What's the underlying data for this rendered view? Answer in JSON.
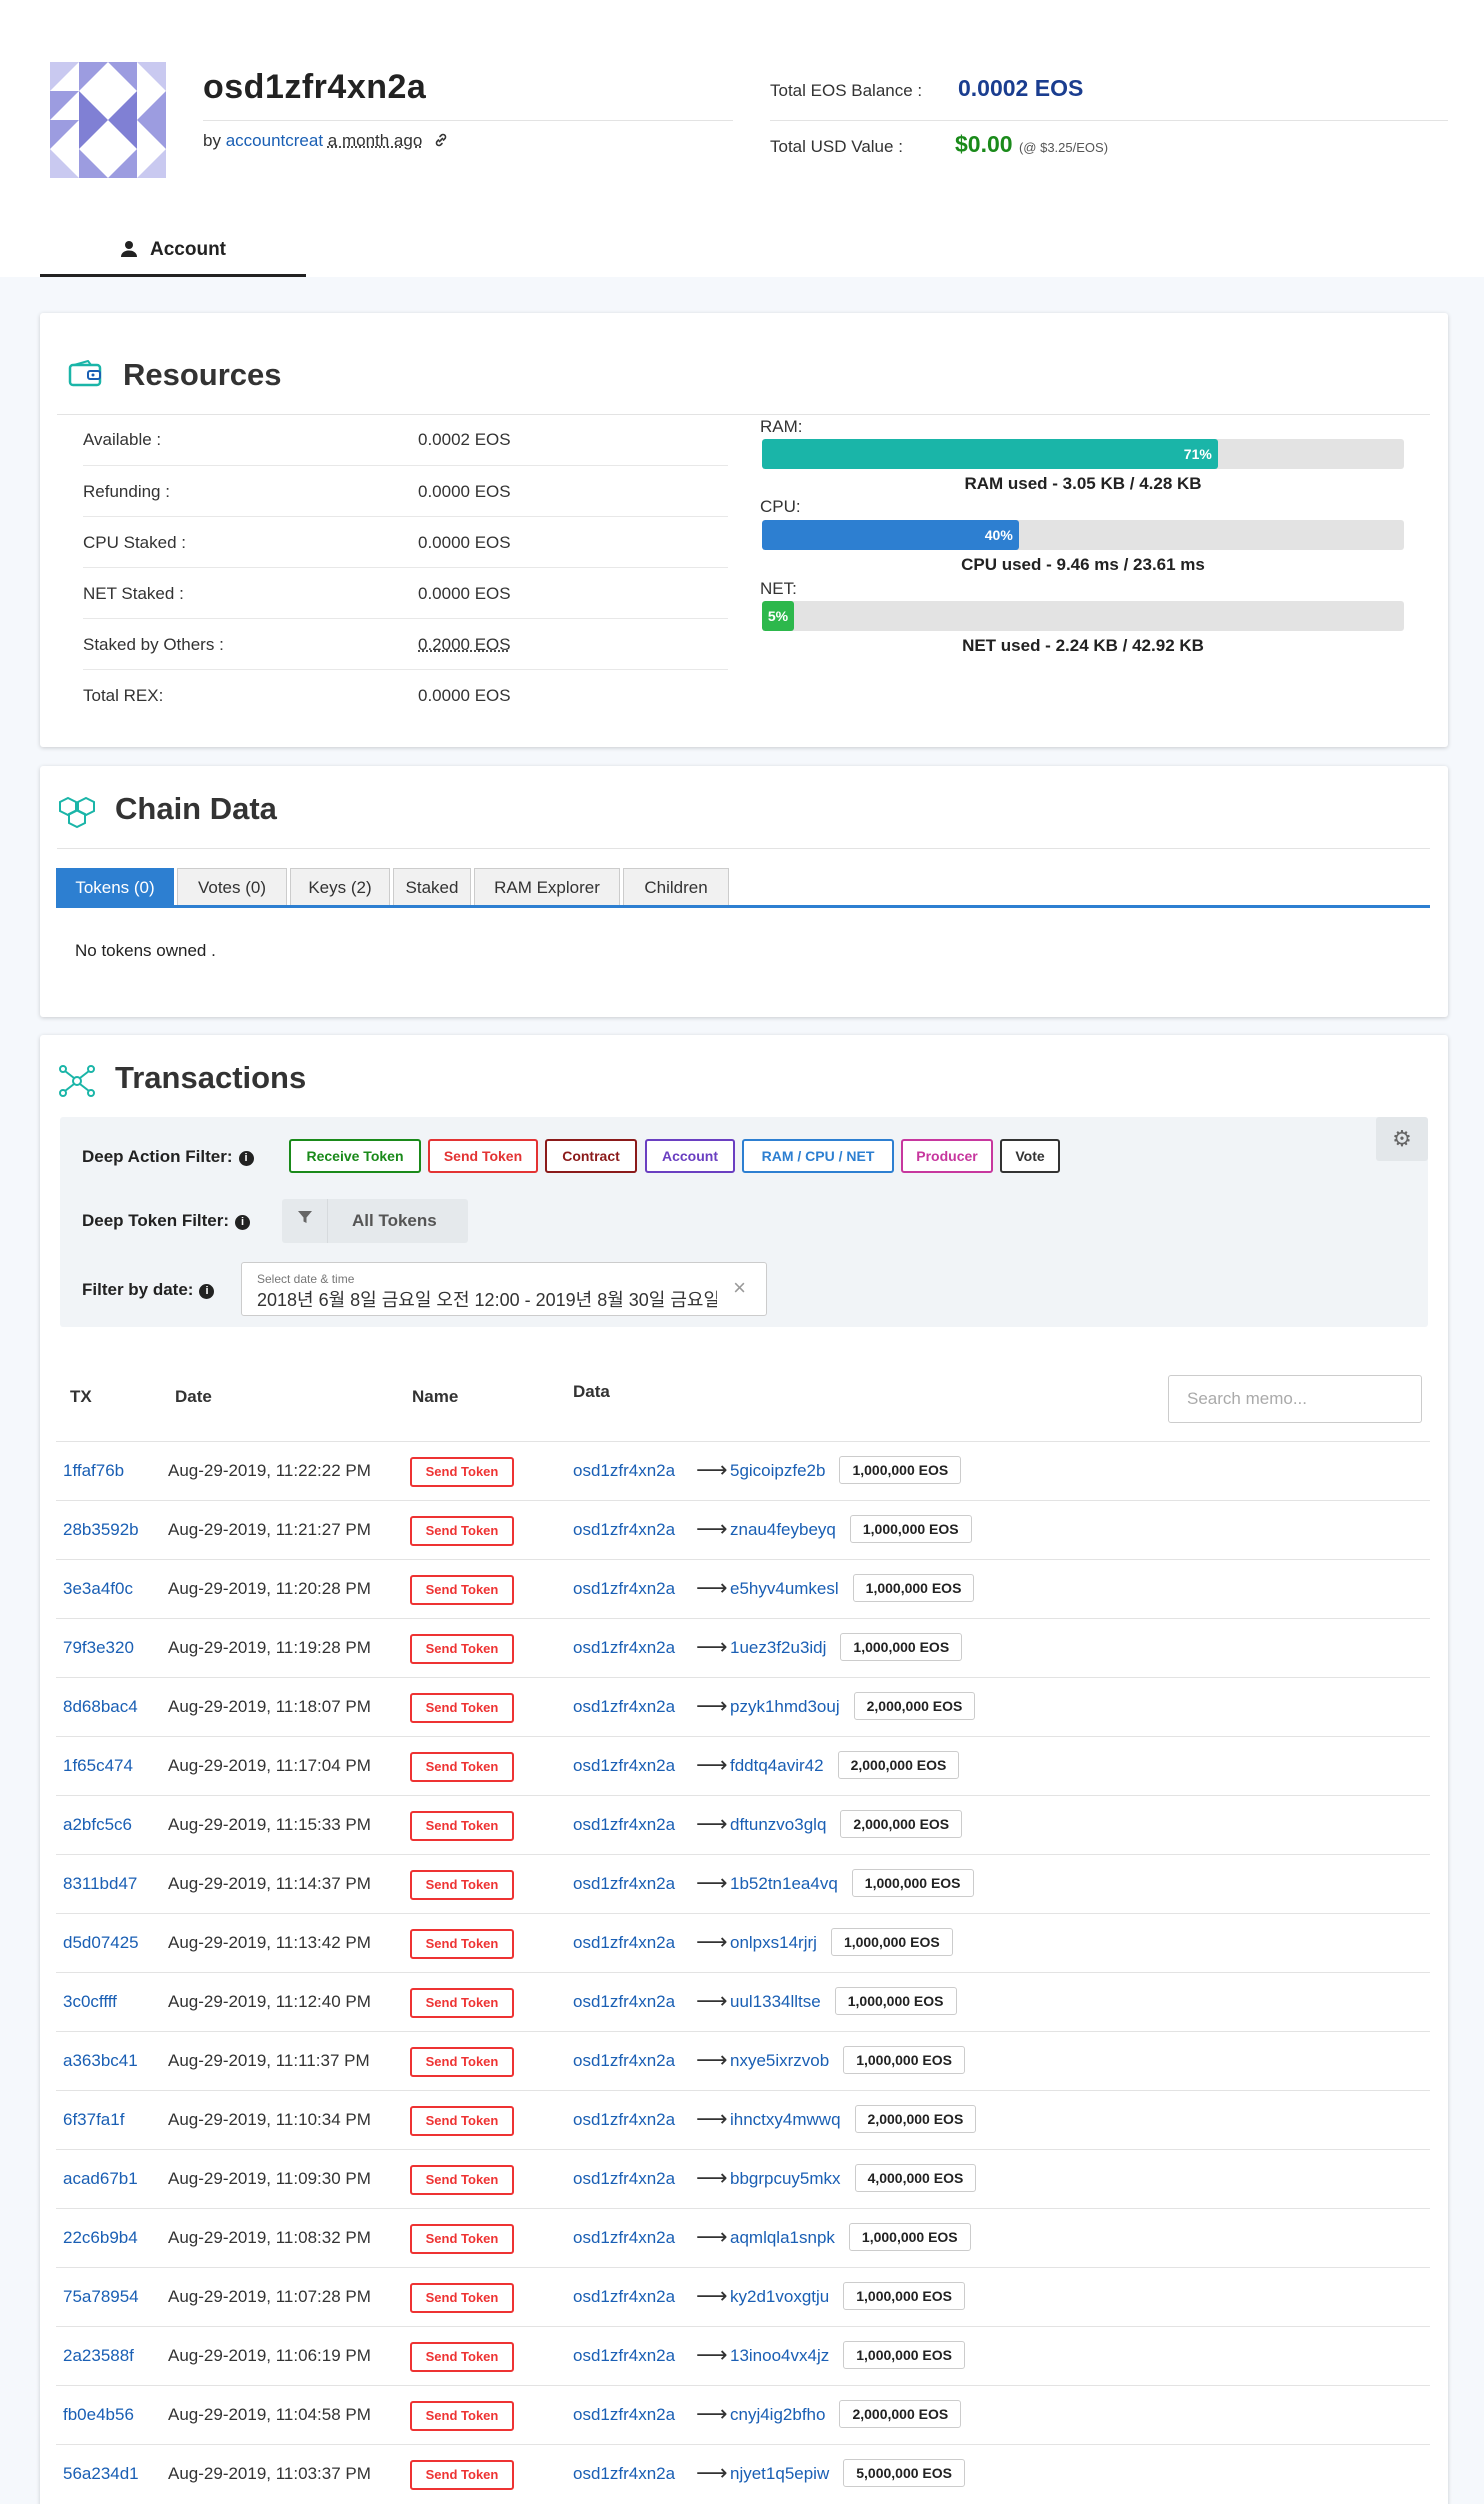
{
  "account": {
    "name": "osd1zfr4xn2a",
    "by_prefix": "by",
    "creator": "accountcreat",
    "created_ago": "a month ago"
  },
  "balance": {
    "eos_label": "Total EOS Balance :",
    "eos_value": "0.0002 EOS",
    "usd_label": "Total USD Value :",
    "usd_value": "$0.00",
    "usd_rate": "(@ $3.25/EOS)"
  },
  "tabs": {
    "account": "Account"
  },
  "resources": {
    "title": "Resources",
    "rows": [
      {
        "label": "Available :",
        "value": "0.0002 EOS"
      },
      {
        "label": "Refunding :",
        "value": "0.0000 EOS"
      },
      {
        "label": "CPU Staked :",
        "value": "0.0000 EOS"
      },
      {
        "label": "NET Staked :",
        "value": "0.0000 EOS"
      },
      {
        "label": "Staked by Others :",
        "value": "0.2000 EOS"
      },
      {
        "label": "Total REX:",
        "value": "0.0000 EOS"
      }
    ],
    "meters": [
      {
        "label": "RAM:",
        "percent": 71,
        "percent_text": "71%",
        "caption": "RAM used - 3.05 KB / 4.28 KB",
        "color": "#1ab5a8"
      },
      {
        "label": "CPU:",
        "percent": 40,
        "percent_text": "40%",
        "caption": "CPU used - 9.46 ms / 23.61 ms",
        "color": "#2d7fd1"
      },
      {
        "label": "NET:",
        "percent": 5,
        "percent_text": "5%",
        "caption": "NET used - 2.24 KB / 42.92 KB",
        "color": "#2db84c"
      }
    ]
  },
  "chain_data": {
    "title": "Chain Data",
    "tabs": [
      "Tokens (0)",
      "Votes (0)",
      "Keys (2)",
      "Staked",
      "RAM Explorer",
      "Children"
    ],
    "empty_text": "No tokens owned ."
  },
  "transactions": {
    "title": "Transactions",
    "deep_action_label": "Deep Action Filter:",
    "deep_token_label": "Deep Token Filter:",
    "date_label": "Filter by date:",
    "action_filters": [
      {
        "label": "Receive Token",
        "color": "#1a8a1a"
      },
      {
        "label": "Send Token",
        "color": "#e33333"
      },
      {
        "label": "Contract",
        "color": "#8b1a1a"
      },
      {
        "label": "Account",
        "color": "#6a3fc1"
      },
      {
        "label": "RAM / CPU / NET",
        "color": "#2d7fd1"
      },
      {
        "label": "Producer",
        "color": "#c7379e"
      },
      {
        "label": "Vote",
        "color": "#333333"
      }
    ],
    "token_filter": "All Tokens",
    "date_caption": "Select date & time",
    "date_value": "2018년 6월 8일 금요일 오전 12:00 - 2019년 8월 30일 금요일",
    "columns": {
      "tx": "TX",
      "date": "Date",
      "name": "Name",
      "data": "Data"
    },
    "memo_placeholder": "Search memo...",
    "rows": [
      {
        "tx": "1ffaf76b",
        "date": "Aug-29-2019, 11:22:22 PM",
        "name": "Send Token",
        "from": "osd1zfr4xn2a",
        "to": "5gicoipzfe2b",
        "amount": "1,000,000 EOS"
      },
      {
        "tx": "28b3592b",
        "date": "Aug-29-2019, 11:21:27 PM",
        "name": "Send Token",
        "from": "osd1zfr4xn2a",
        "to": "znau4feybeyq",
        "amount": "1,000,000 EOS"
      },
      {
        "tx": "3e3a4f0c",
        "date": "Aug-29-2019, 11:20:28 PM",
        "name": "Send Token",
        "from": "osd1zfr4xn2a",
        "to": "e5hyv4umkesl",
        "amount": "1,000,000 EOS"
      },
      {
        "tx": "79f3e320",
        "date": "Aug-29-2019, 11:19:28 PM",
        "name": "Send Token",
        "from": "osd1zfr4xn2a",
        "to": "1uez3f2u3idj",
        "amount": "1,000,000 EOS"
      },
      {
        "tx": "8d68bac4",
        "date": "Aug-29-2019, 11:18:07 PM",
        "name": "Send Token",
        "from": "osd1zfr4xn2a",
        "to": "pzyk1hmd3ouj",
        "amount": "2,000,000 EOS"
      },
      {
        "tx": "1f65c474",
        "date": "Aug-29-2019, 11:17:04 PM",
        "name": "Send Token",
        "from": "osd1zfr4xn2a",
        "to": "fddtq4avir42",
        "amount": "2,000,000 EOS"
      },
      {
        "tx": "a2bfc5c6",
        "date": "Aug-29-2019, 11:15:33 PM",
        "name": "Send Token",
        "from": "osd1zfr4xn2a",
        "to": "dftunzvo3glq",
        "amount": "2,000,000 EOS"
      },
      {
        "tx": "8311bd47",
        "date": "Aug-29-2019, 11:14:37 PM",
        "name": "Send Token",
        "from": "osd1zfr4xn2a",
        "to": "1b52tn1ea4vq",
        "amount": "1,000,000 EOS"
      },
      {
        "tx": "d5d07425",
        "date": "Aug-29-2019, 11:13:42 PM",
        "name": "Send Token",
        "from": "osd1zfr4xn2a",
        "to": "onlpxs14rjrj",
        "amount": "1,000,000 EOS"
      },
      {
        "tx": "3c0cffff",
        "date": "Aug-29-2019, 11:12:40 PM",
        "name": "Send Token",
        "from": "osd1zfr4xn2a",
        "to": "uul1334lltse",
        "amount": "1,000,000 EOS"
      },
      {
        "tx": "a363bc41",
        "date": "Aug-29-2019, 11:11:37 PM",
        "name": "Send Token",
        "from": "osd1zfr4xn2a",
        "to": "nxye5ixrzvob",
        "amount": "1,000,000 EOS"
      },
      {
        "tx": "6f37fa1f",
        "date": "Aug-29-2019, 11:10:34 PM",
        "name": "Send Token",
        "from": "osd1zfr4xn2a",
        "to": "ihnctxy4mwwq",
        "amount": "2,000,000 EOS"
      },
      {
        "tx": "acad67b1",
        "date": "Aug-29-2019, 11:09:30 PM",
        "name": "Send Token",
        "from": "osd1zfr4xn2a",
        "to": "bbgrpcuy5mkx",
        "amount": "4,000,000 EOS"
      },
      {
        "tx": "22c6b9b4",
        "date": "Aug-29-2019, 11:08:32 PM",
        "name": "Send Token",
        "from": "osd1zfr4xn2a",
        "to": "aqmlqla1snpk",
        "amount": "1,000,000 EOS"
      },
      {
        "tx": "75a78954",
        "date": "Aug-29-2019, 11:07:28 PM",
        "name": "Send Token",
        "from": "osd1zfr4xn2a",
        "to": "ky2d1voxgtju",
        "amount": "1,000,000 EOS"
      },
      {
        "tx": "2a23588f",
        "date": "Aug-29-2019, 11:06:19 PM",
        "name": "Send Token",
        "from": "osd1zfr4xn2a",
        "to": "13inoo4vx4jz",
        "amount": "1,000,000 EOS"
      },
      {
        "tx": "fb0e4b56",
        "date": "Aug-29-2019, 11:04:58 PM",
        "name": "Send Token",
        "from": "osd1zfr4xn2a",
        "to": "cnyj4ig2bfho",
        "amount": "2,000,000 EOS"
      },
      {
        "tx": "56a234d1",
        "date": "Aug-29-2019, 11:03:37 PM",
        "name": "Send Token",
        "from": "osd1zfr4xn2a",
        "to": "njyet1q5epiw",
        "amount": "5,000,000 EOS"
      }
    ]
  }
}
